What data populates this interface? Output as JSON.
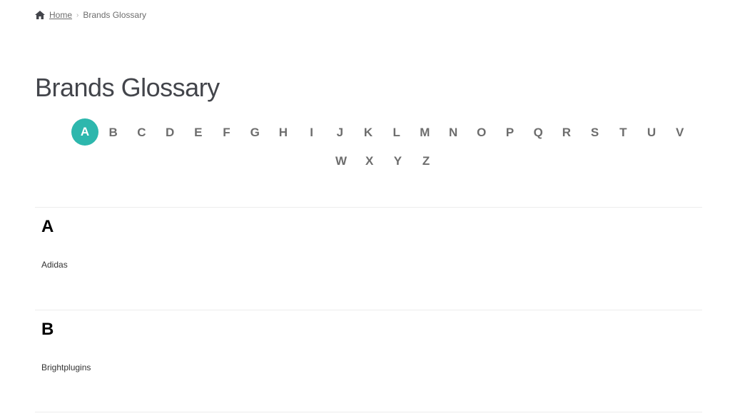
{
  "breadcrumb": {
    "home_icon": "home-icon",
    "home_label": "Home",
    "separator": "›",
    "current": "Brands Glossary"
  },
  "page_title": "Brands Glossary",
  "letters": {
    "active": "A",
    "accent_color": "#2db7ad",
    "row1": [
      "A",
      "B",
      "C",
      "D",
      "E",
      "F",
      "G",
      "H",
      "I",
      "J",
      "K",
      "L",
      "M",
      "N",
      "O",
      "P",
      "Q",
      "R",
      "S",
      "T",
      "U",
      "V"
    ],
    "row2": [
      "W",
      "X",
      "Y",
      "Z"
    ]
  },
  "sections": [
    {
      "letter": "A",
      "brands": [
        "Adidas"
      ]
    },
    {
      "letter": "B",
      "brands": [
        "Brightplugins"
      ]
    }
  ]
}
